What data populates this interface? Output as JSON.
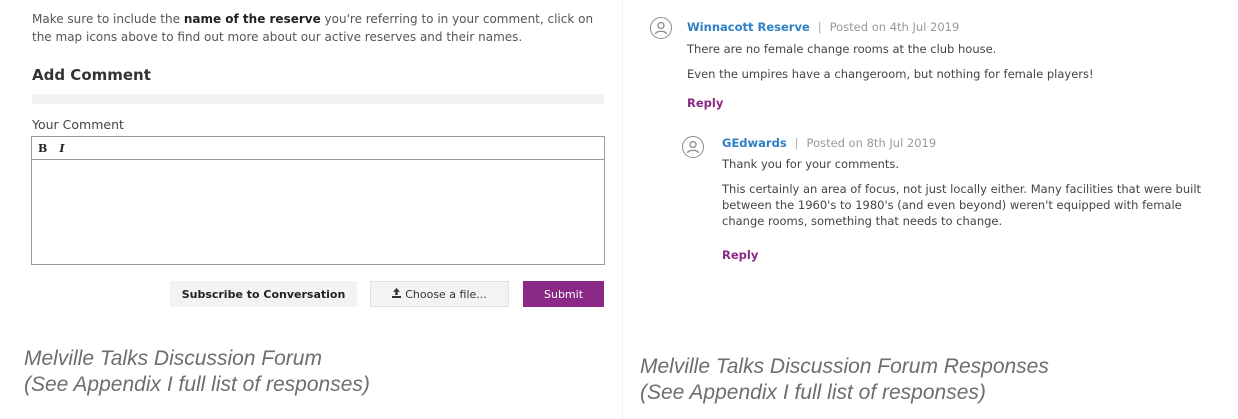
{
  "left": {
    "instructions": {
      "pre": "Make sure to include the ",
      "bold": "name of the reserve",
      "post": " you're referring to in your comment, click on the map icons above to find out more about our active reserves and their names."
    },
    "add_comment_title": "Add Comment",
    "your_comment_label": "Your Comment",
    "toolbar": {
      "bold_label": "B",
      "italic_label": "I"
    },
    "comment_value": "",
    "buttons": {
      "subscribe": "Subscribe to Conversation",
      "upload_icon": "upload-icon",
      "choose_file": "Choose a file...",
      "submit": "Submit"
    },
    "caption_line1": "Melville Talks Discussion Forum",
    "caption_line2": "(See Appendix I full list of responses)"
  },
  "right": {
    "comments": [
      {
        "author": "Winnacott Reserve",
        "separator": "|",
        "posted": "Posted on 4th Jul 2019",
        "lines": [
          "There are no female change rooms at the club house.",
          "Even the umpires have a changeroom, but nothing for female players!"
        ],
        "reply_label": "Reply"
      },
      {
        "author": "GEdwards",
        "separator": "|",
        "posted": "Posted on 8th Jul 2019",
        "lines": [
          "Thank you for your comments.",
          "This certainly an area of focus, not just locally either. Many facilities that were built",
          "between the 1960's to 1980's (and even beyond) weren't equipped with female",
          "change rooms, something that needs to change."
        ],
        "reply_label": "Reply"
      }
    ],
    "caption_line1": "Melville Talks Discussion Forum Responses",
    "caption_line2": "(See Appendix I full list of responses)"
  },
  "colors": {
    "accent_purple": "#8a2a86",
    "link_blue": "#2e7fc4",
    "caption_grey": "#6d6d6d"
  }
}
